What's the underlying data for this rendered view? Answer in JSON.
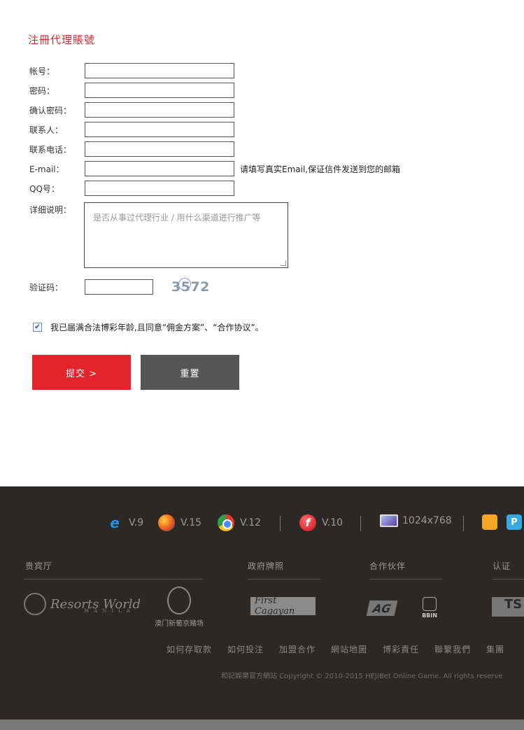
{
  "form": {
    "title": "注冊代理賬號",
    "fields": [
      {
        "label": "帐号："
      },
      {
        "label": "密码："
      },
      {
        "label": "确认密码："
      },
      {
        "label": "联系人："
      },
      {
        "label": "联系电话："
      },
      {
        "label": "E-mail：",
        "hint": "请填写真实Email,保证信件发送到您的邮箱"
      },
      {
        "label": "QQ号："
      }
    ],
    "details_label": "详细说明：",
    "details_placeholder": "是否从事过代理行业 / 用什么渠道进行推广等",
    "captcha_label": "验证码：",
    "captcha_code": "3572",
    "agree_checked": true,
    "agree_text": "我已届满合法博彩年龄,且同意“佣金方案”、“合作协议”。",
    "submit_label": "提交 >",
    "reset_label": "重置"
  },
  "footer": {
    "browsers": [
      {
        "icon": "ie-icon",
        "version": "V.9"
      },
      {
        "icon": "firefox-icon",
        "version": "V.15"
      },
      {
        "icon": "chrome-icon",
        "version": "V.12"
      },
      {
        "icon": "flash-icon",
        "version": "V.10"
      },
      {
        "icon": "monitor-icon",
        "version": "1024x768"
      }
    ],
    "sections": {
      "vip": "贵宾厅",
      "license": "政府牌照",
      "partners": "合作伙伴",
      "certification": "认证"
    },
    "logos": {
      "resorts_world": "Resorts World",
      "resorts_world_sub": "MANILA",
      "lisboa": "澳门新葡京赌场",
      "cagayan": "First Cagayan",
      "ag": "AG",
      "bbin": "BBIN",
      "tst": "TS"
    },
    "links": [
      "如何存取款",
      "如何投注",
      "加盟合作",
      "網站地圖",
      "博彩責任",
      "聯繫我們",
      "集團"
    ],
    "copyright": "和記娛樂官方網站 Copyright © 2010-2015 HEJIBet Online Game. All rights reserve"
  }
}
